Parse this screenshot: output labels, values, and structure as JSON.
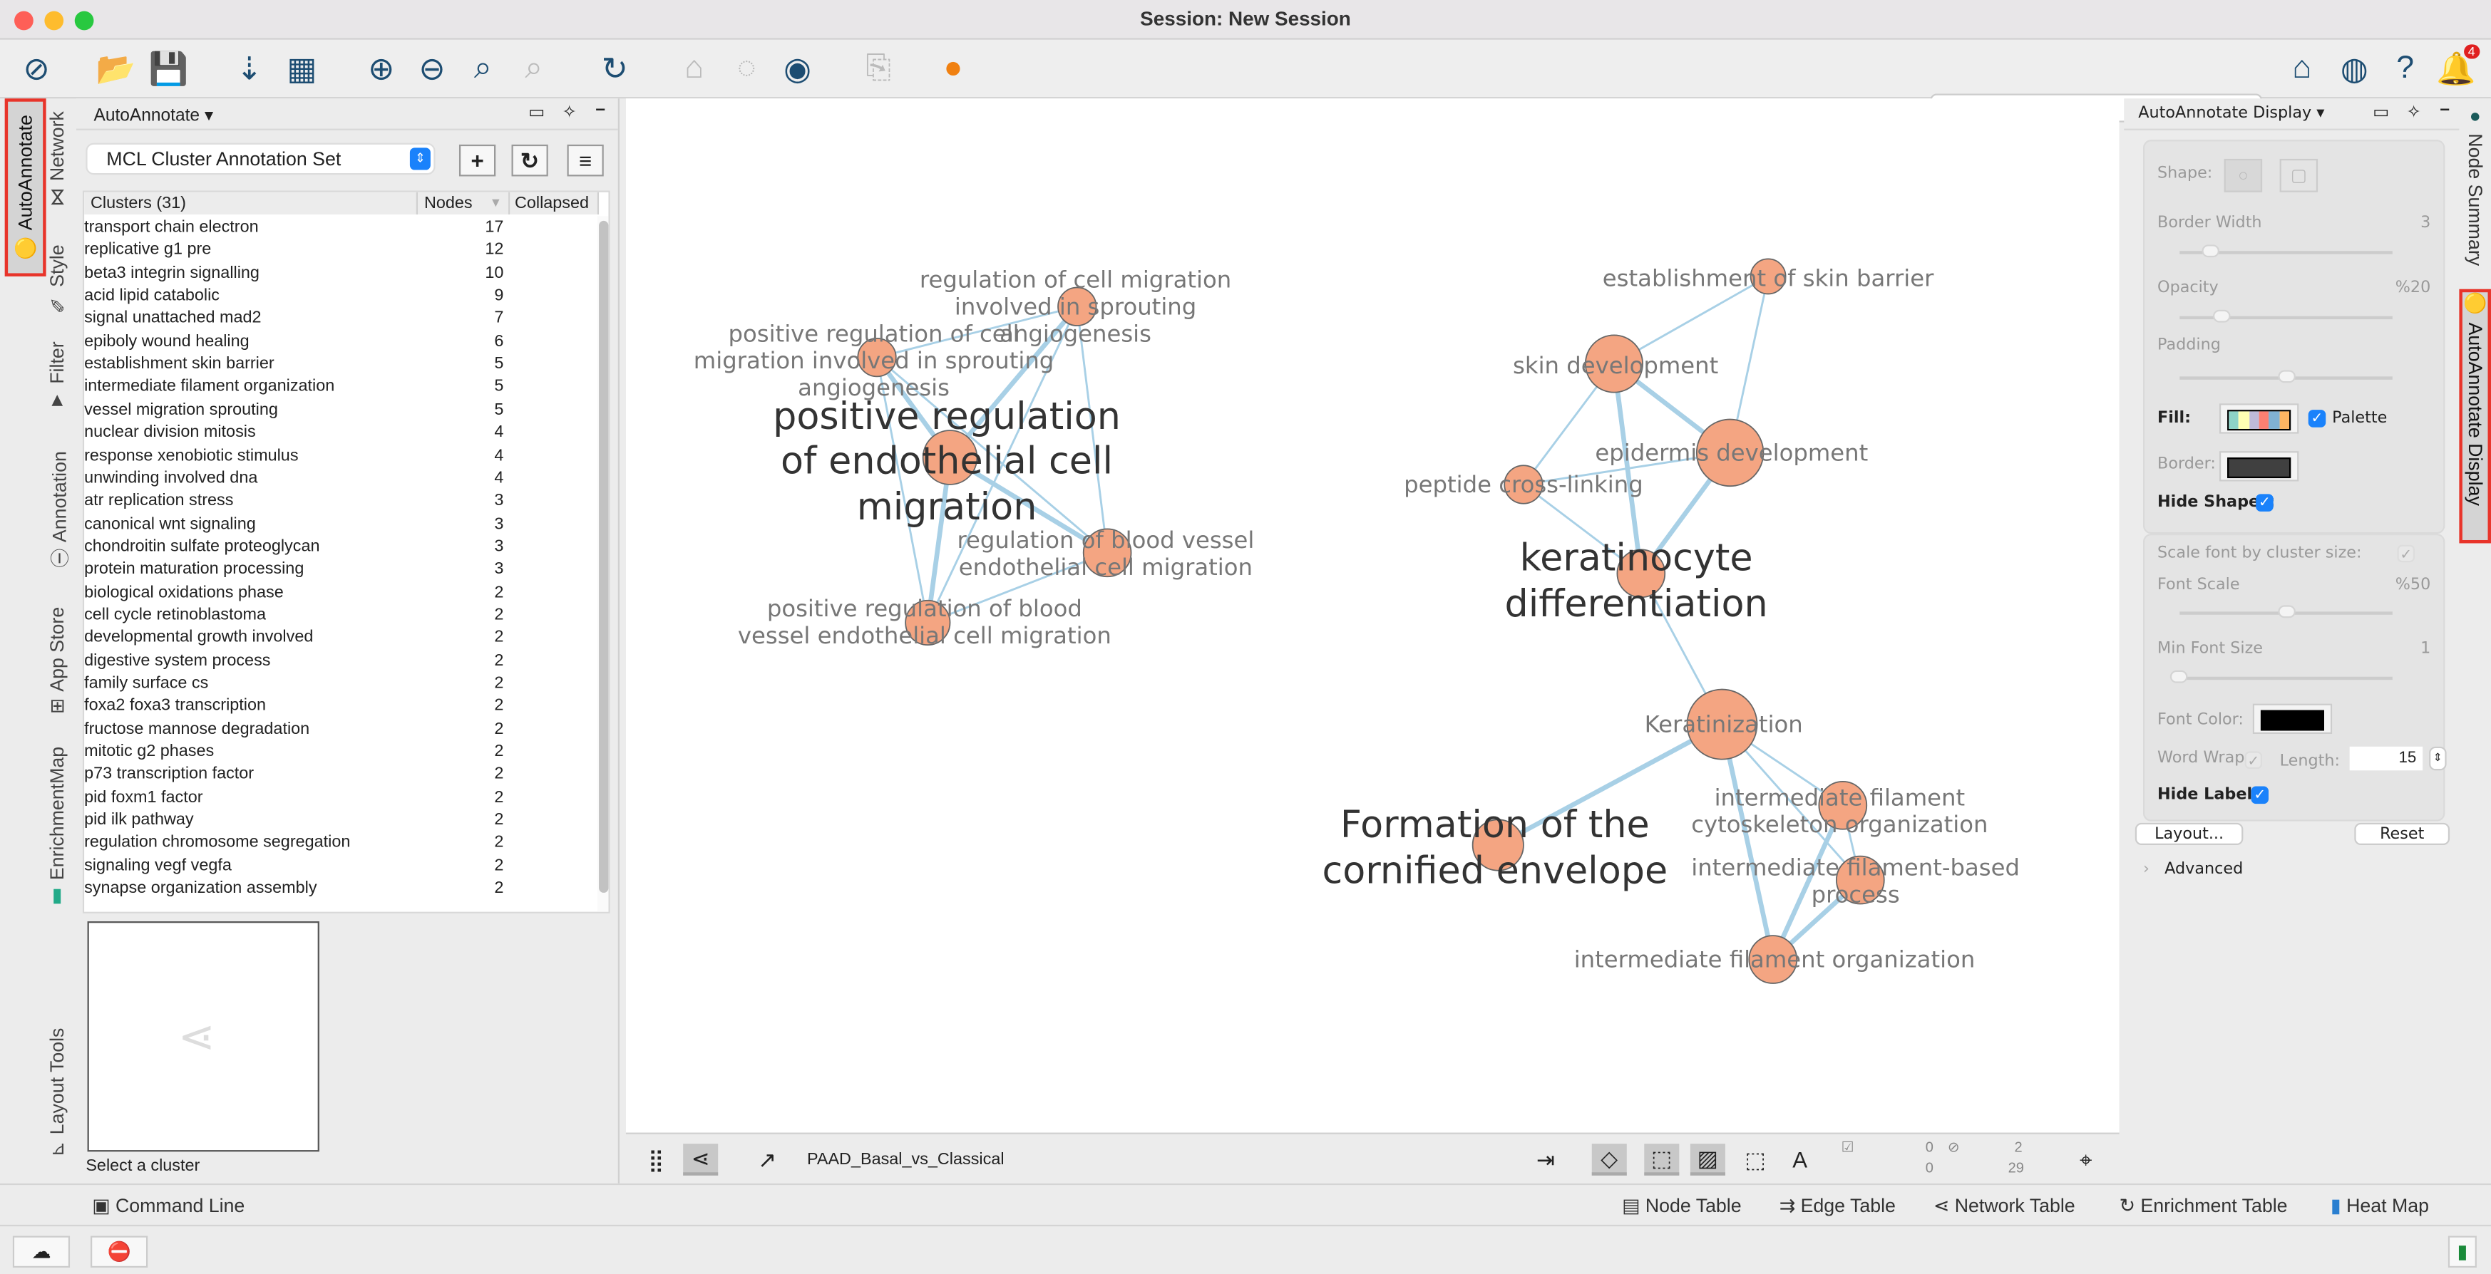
{
  "window": {
    "title": "Session: New Session"
  },
  "toolbar": {
    "search_placeholder": "",
    "notification_count": "4"
  },
  "left_tabs": [
    "AutoAnnotate",
    "Network",
    "Style",
    "Filter",
    "Annotation",
    "App Store",
    "EnrichmentMap",
    "Layout Tools"
  ],
  "left_panel": {
    "title": "AutoAnnotate",
    "annotation_set": "MCL Cluster Annotation Set",
    "columns": {
      "clusters": "Clusters (31)",
      "nodes": "Nodes",
      "collapsed": "Collapsed"
    },
    "clusters": [
      {
        "label": "transport chain electron",
        "nodes": "17"
      },
      {
        "label": "replicative g1 pre",
        "nodes": "12"
      },
      {
        "label": "beta3 integrin signalling",
        "nodes": "10"
      },
      {
        "label": "acid lipid catabolic",
        "nodes": "9"
      },
      {
        "label": "signal unattached mad2",
        "nodes": "7"
      },
      {
        "label": "epiboly wound healing",
        "nodes": "6"
      },
      {
        "label": "establishment skin barrier",
        "nodes": "5"
      },
      {
        "label": "intermediate filament organization",
        "nodes": "5"
      },
      {
        "label": "vessel migration sprouting",
        "nodes": "5"
      },
      {
        "label": "nuclear division mitosis",
        "nodes": "4"
      },
      {
        "label": "response xenobiotic stimulus",
        "nodes": "4"
      },
      {
        "label": "unwinding involved dna",
        "nodes": "4"
      },
      {
        "label": "atr replication stress",
        "nodes": "3"
      },
      {
        "label": "canonical wnt signaling",
        "nodes": "3"
      },
      {
        "label": "chondroitin sulfate proteoglycan",
        "nodes": "3"
      },
      {
        "label": "protein maturation processing",
        "nodes": "3"
      },
      {
        "label": "biological oxidations phase",
        "nodes": "2"
      },
      {
        "label": "cell cycle retinoblastoma",
        "nodes": "2"
      },
      {
        "label": "developmental growth involved",
        "nodes": "2"
      },
      {
        "label": "digestive system process",
        "nodes": "2"
      },
      {
        "label": "family surface cs",
        "nodes": "2"
      },
      {
        "label": "foxa2 foxa3 transcription",
        "nodes": "2"
      },
      {
        "label": "fructose mannose degradation",
        "nodes": "2"
      },
      {
        "label": "mitotic g2 phases",
        "nodes": "2"
      },
      {
        "label": "p73 transcription factor",
        "nodes": "2"
      },
      {
        "label": "pid foxm1 factor",
        "nodes": "2"
      },
      {
        "label": "pid ilk pathway",
        "nodes": "2"
      },
      {
        "label": "regulation chromosome segregation",
        "nodes": "2"
      },
      {
        "label": "signaling vegf vegfa",
        "nodes": "2"
      },
      {
        "label": "synapse organization assembly",
        "nodes": "2"
      }
    ],
    "preview_caption": "Select a cluster"
  },
  "network": {
    "name": "PAAD_Basal_vs_Classical",
    "node_color": "#f4a582",
    "edge_color": "#a8d0e6",
    "nodes": [
      {
        "id": "A",
        "label": "regulation of cell migration involved in sprouting angiogenesis"
      },
      {
        "id": "B",
        "label": "positive regulation of cell migration involved in sprouting angiogenesis"
      },
      {
        "id": "C",
        "label": ""
      },
      {
        "id": "D",
        "label": "regulation of blood vessel endothelial cell migration"
      },
      {
        "id": "E",
        "label": "positive regulation of blood vessel endothelial cell migration"
      },
      {
        "id": "F",
        "label": "establishment of skin barrier"
      },
      {
        "id": "G",
        "label": "skin development"
      },
      {
        "id": "H",
        "label": "epidermis development"
      },
      {
        "id": "I",
        "label": "peptide cross-linking"
      },
      {
        "id": "J",
        "label": ""
      },
      {
        "id": "K",
        "label": "Keratinization"
      },
      {
        "id": "L",
        "label": "intermediate filament cytoskeleton organization"
      },
      {
        "id": "M",
        "label": ""
      },
      {
        "id": "N",
        "label": "intermediate filament-based process"
      },
      {
        "id": "O",
        "label": "intermediate filament organization"
      }
    ],
    "edges": [
      [
        "A",
        "B"
      ],
      [
        "A",
        "C"
      ],
      [
        "A",
        "D"
      ],
      [
        "A",
        "E"
      ],
      [
        "B",
        "C"
      ],
      [
        "B",
        "E"
      ],
      [
        "B",
        "D"
      ],
      [
        "C",
        "D"
      ],
      [
        "C",
        "E"
      ],
      [
        "D",
        "E"
      ],
      [
        "F",
        "G"
      ],
      [
        "F",
        "H"
      ],
      [
        "G",
        "H"
      ],
      [
        "G",
        "I"
      ],
      [
        "G",
        "J"
      ],
      [
        "H",
        "J"
      ],
      [
        "I",
        "H"
      ],
      [
        "I",
        "J"
      ],
      [
        "J",
        "K"
      ],
      [
        "K",
        "M"
      ],
      [
        "K",
        "L"
      ],
      [
        "K",
        "N"
      ],
      [
        "K",
        "O"
      ],
      [
        "L",
        "N"
      ],
      [
        "L",
        "O"
      ],
      [
        "N",
        "O"
      ]
    ],
    "cluster_labels": [
      "positive regulation of endothelial cell migration",
      "keratinocyte differentiation",
      "Formation of the cornified envelope"
    ],
    "stats": {
      "selected_nodes": "0",
      "selected_edges": "0",
      "hidden_nodes": "2",
      "hidden_edges": "29"
    }
  },
  "right_panel": {
    "title": "AutoAnnotate Display",
    "shape_label": "Shape:",
    "border_width_label": "Border Width",
    "border_width": "3",
    "border_width_value": 3,
    "opacity_label": "Opacity",
    "opacity": "%20",
    "opacity_value": 20,
    "padding_label": "Padding",
    "padding_value": 50,
    "fill_label": "Fill:",
    "palette_label": "Palette",
    "palette_checked": true,
    "palette_colors": [
      "#8dd3c7",
      "#ffffb3",
      "#bebada",
      "#fb8072",
      "#80b1d3",
      "#fdb462"
    ],
    "border_label": "Border:",
    "border_color": "#404040",
    "hide_shapes_label": "Hide Shapes:",
    "hide_shapes": true,
    "scale_font_label": "Scale font by cluster size:",
    "font_scale_label": "Font Scale",
    "font_scale": "%50",
    "font_scale_value": 50,
    "min_font_label": "Min Font Size",
    "min_font": "1",
    "font_color_label": "Font Color:",
    "font_color": "#000000",
    "word_wrap_label": "Word Wrap:",
    "length_label": "Length:",
    "length": "15",
    "hide_labels_label": "Hide Labels:",
    "hide_labels": true,
    "layout_button": "Layout...",
    "reset_button": "Reset",
    "advanced_label": "Advanced"
  },
  "right_tabs": [
    "Node Summary",
    "AutoAnnotate Display"
  ],
  "bottom_tabs": {
    "command_line": "Command Line",
    "tables": [
      "Node Table",
      "Edge Table",
      "Network Table",
      "Enrichment Table",
      "Heat Map"
    ]
  }
}
